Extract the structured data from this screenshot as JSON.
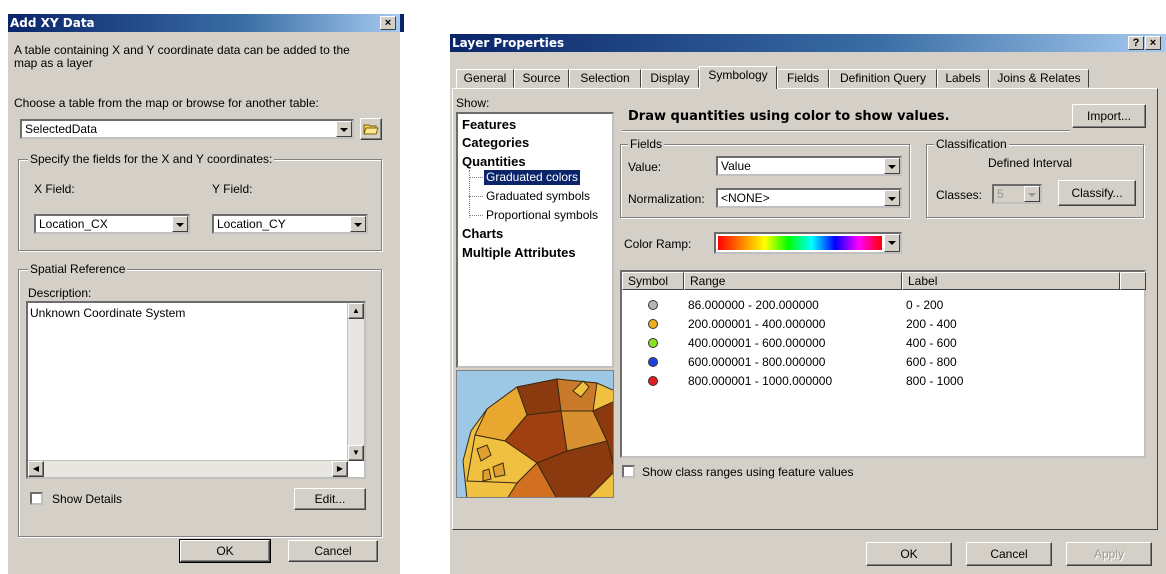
{
  "add_xy": {
    "title": "Add XY Data",
    "close_label": "×",
    "intro_text": "A table containing X and Y coordinate data can be added to the map as a layer",
    "choose_label": "Choose a table from the map or browse for another table:",
    "table_value": "SelectedData",
    "fields_group_label": "Specify the fields for the X and Y coordinates:",
    "x_label": "X Field:",
    "y_label": "Y Field:",
    "x_value": "Location_CX",
    "y_value": "Location_CY",
    "spatial_group_label": "Spatial Reference",
    "description_label": "Description:",
    "description_value": "Unknown Coordinate System",
    "show_details_label": "Show Details",
    "edit_label": "Edit...",
    "ok_label": "OK",
    "cancel_label": "Cancel"
  },
  "layer_props": {
    "title": "Layer Properties",
    "help_label": "?",
    "close_label": "×",
    "tabs": [
      "General",
      "Source",
      "Selection",
      "Display",
      "Symbology",
      "Fields",
      "Definition Query",
      "Labels",
      "Joins & Relates"
    ],
    "selected_tab": "Symbology",
    "show_label": "Show:",
    "tree": {
      "features": "Features",
      "categories": "Categories",
      "quantities": "Quantities",
      "graduated_colors": "Graduated colors",
      "graduated_symbols": "Graduated symbols",
      "proportional_symbols": "Proportional symbols",
      "charts": "Charts",
      "multiple_attributes": "Multiple Attributes"
    },
    "heading": "Draw quantities using color to show values.",
    "import_label": "Import...",
    "fields_group_label": "Fields",
    "value_label": "Value:",
    "value_value": "Value",
    "normalization_label": "Normalization:",
    "normalization_value": "<NONE>",
    "classification_group_label": "Classification",
    "classification_method": "Defined Interval",
    "classes_label": "Classes:",
    "classes_value": "5",
    "classify_label": "Classify...",
    "color_ramp_label": "Color Ramp:",
    "columns": [
      "Symbol",
      "Range",
      "Label"
    ],
    "rows": [
      {
        "color": "#b4b4b4",
        "range": "86.000000 - 200.000000",
        "label": "0 - 200"
      },
      {
        "color": "#f0b020",
        "range": "200.000001 - 400.000000",
        "label": "200 - 400"
      },
      {
        "color": "#90e020",
        "range": "400.000001 - 600.000000",
        "label": "400 - 600"
      },
      {
        "color": "#2040e0",
        "range": "600.000001 - 800.000000",
        "label": "600 - 800"
      },
      {
        "color": "#e02020",
        "range": "800.000001 - 1000.000000",
        "label": "800 - 1000"
      }
    ],
    "show_class_ranges_label": "Show class ranges using feature values",
    "ok_label": "OK",
    "cancel_label": "Cancel",
    "apply_label": "Apply"
  },
  "colors": {
    "dialog_bg": "#d4d0c8",
    "title_gradient_start": "#0a246a",
    "selection": "#0a246a"
  }
}
